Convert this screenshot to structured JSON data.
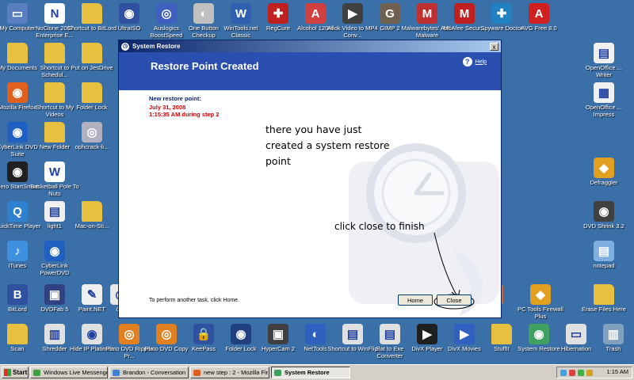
{
  "desktop": {
    "icons": [
      {
        "label": "My Computer",
        "icon": "computer-icon",
        "color": "#5a7fc0",
        "glyph": "▭"
      },
      {
        "label": "NoClone 2007 Enterprise E...",
        "icon": "noclone-icon",
        "color": "#ffffff",
        "glyph": "N"
      },
      {
        "label": "Shortcut to BitLord",
        "icon": "folder-icon",
        "color": "#e8c040",
        "glyph": ""
      },
      {
        "label": "UltraISO",
        "icon": "ultraiso-icon",
        "color": "#3050a0",
        "glyph": "◉"
      },
      {
        "label": "Auslogics BoostSpeed",
        "icon": "auslogics-icon",
        "color": "#4060c0",
        "glyph": "◎"
      },
      {
        "label": "One Button Checkup",
        "icon": "checkup-icon",
        "color": "#c0c0c0",
        "glyph": "◐"
      },
      {
        "label": "WinTools.net Classic",
        "icon": "wintools-icon",
        "color": "#3060b0",
        "glyph": "W"
      },
      {
        "label": "RegCure",
        "icon": "regcure-icon",
        "color": "#c02020",
        "glyph": "✚"
      },
      {
        "label": "Alcohol 120%",
        "icon": "alcohol-icon",
        "color": "#d04040",
        "glyph": "A"
      },
      {
        "label": "Allok Video to MP4 Conv...",
        "icon": "allok-icon",
        "color": "#404040",
        "glyph": "▶"
      },
      {
        "label": "GIMP 2",
        "icon": "gimp-icon",
        "color": "#706050",
        "glyph": "G"
      },
      {
        "label": "Malwarebytes' Anti-Malware",
        "icon": "malwarebytes-icon",
        "color": "#c03030",
        "glyph": "M"
      },
      {
        "label": "McAfee Secur...",
        "icon": "mcafee-icon",
        "color": "#c02020",
        "glyph": "M"
      },
      {
        "label": "Spyware Doctor",
        "icon": "spyware-doctor-icon",
        "color": "#2080c0",
        "glyph": "✚"
      },
      {
        "label": "AVG Free 8.0",
        "icon": "avg-icon",
        "color": "#d02020",
        "glyph": "A"
      },
      {
        "label": "My Documents",
        "icon": "documents-icon",
        "color": "#e8c040",
        "glyph": ""
      },
      {
        "label": "Shortcut to Schedul...",
        "icon": "shortcut-icon",
        "color": "#e8c040",
        "glyph": ""
      },
      {
        "label": "Put on JesDrive",
        "icon": "folder-icon",
        "color": "#e8c040",
        "glyph": ""
      },
      {
        "label": "Mozilla Firefox",
        "icon": "firefox-icon",
        "color": "#e06020",
        "glyph": "◉"
      },
      {
        "label": "Shortcut to My Videos",
        "icon": "shortcut-icon",
        "color": "#e8c040",
        "glyph": ""
      },
      {
        "label": "Folder Lock",
        "icon": "folder-icon",
        "color": "#e8c040",
        "glyph": ""
      },
      {
        "label": "CyberLink DVD Suite",
        "icon": "cyberlink-icon",
        "color": "#2060c0",
        "glyph": "◉"
      },
      {
        "label": "New Folder",
        "icon": "folder-icon",
        "color": "#e8c040",
        "glyph": ""
      },
      {
        "label": "ophcrack-li...",
        "icon": "disc-icon",
        "color": "#b0b0c0",
        "glyph": "◎"
      },
      {
        "label": "Nero StartSmart",
        "icon": "nero-icon",
        "color": "#202020",
        "glyph": "◉"
      },
      {
        "label": "Basketball Pole To Nuts",
        "icon": "document-icon",
        "color": "#ffffff",
        "glyph": "W"
      },
      {
        "label": "QuickTime Player",
        "icon": "quicktime-icon",
        "color": "#3080d0",
        "glyph": "Q"
      },
      {
        "label": "light1",
        "icon": "image-icon",
        "color": "#f0f0f0",
        "glyph": "▤"
      },
      {
        "label": "Mac-on-Sti...",
        "icon": "folder-icon",
        "color": "#e8c040",
        "glyph": ""
      },
      {
        "label": "iTunes",
        "icon": "itunes-icon",
        "color": "#4090e0",
        "glyph": "♪"
      },
      {
        "label": "CyberLink PowerDVD",
        "icon": "powerdvd-icon",
        "color": "#2060c0",
        "glyph": "◉"
      },
      {
        "label": "BitLord",
        "icon": "bitlord-icon",
        "color": "#3050a0",
        "glyph": "B"
      },
      {
        "label": "DVDFab 5",
        "icon": "dvdfab-icon",
        "color": "#304080",
        "glyph": "▣"
      },
      {
        "label": "Paint.NET",
        "icon": "paint-icon",
        "color": "#f0f0f0",
        "glyph": "✎"
      },
      {
        "label": "CD",
        "icon": "cd-icon",
        "color": "#e8e8e8",
        "glyph": "◎"
      },
      {
        "label": "ntFire",
        "icon": "fire-icon",
        "color": "#e06020",
        "glyph": "▲"
      },
      {
        "label": "PC Tools Firewall Plus",
        "icon": "firewall-icon",
        "color": "#e0a020",
        "glyph": "◆"
      },
      {
        "label": "Erase Files Here",
        "icon": "folder-icon",
        "color": "#e8c040",
        "glyph": ""
      },
      {
        "label": "OpenOffice.... Writer",
        "icon": "writer-icon",
        "color": "#f0f0f0",
        "glyph": "▤"
      },
      {
        "label": "OpenOffice.... Impress",
        "icon": "impress-icon",
        "color": "#f0f0f0",
        "glyph": "▦"
      },
      {
        "label": "Defraggler",
        "icon": "defraggler-icon",
        "color": "#e0a020",
        "glyph": "◆"
      },
      {
        "label": "DVD Shrink 3.2",
        "icon": "dvdshrink-icon",
        "color": "#404040",
        "glyph": "◉"
      },
      {
        "label": "notepad",
        "icon": "notepad-icon",
        "color": "#80b0e0",
        "glyph": "▤"
      },
      {
        "label": "Scan",
        "icon": "folder-icon",
        "color": "#e8c040",
        "glyph": ""
      },
      {
        "label": "Shredder",
        "icon": "shredder-icon",
        "color": "#e0e0e0",
        "glyph": "▥"
      },
      {
        "label": "Hide IP Platinum",
        "icon": "hideip-icon",
        "color": "#e0e0e0",
        "glyph": "◉"
      },
      {
        "label": "Plato DVD Ripper Pr...",
        "icon": "plato-icon",
        "color": "#e08020",
        "glyph": "◎"
      },
      {
        "label": "Plato DVD Copy",
        "icon": "plato-icon",
        "color": "#e08020",
        "glyph": "◎"
      },
      {
        "label": "KeePass",
        "icon": "keepass-icon",
        "color": "#3050a0",
        "glyph": "🔒"
      },
      {
        "label": "Folder Lock",
        "icon": "folderlock-icon",
        "color": "#204080",
        "glyph": "◉"
      },
      {
        "label": "HyperCam 2",
        "icon": "hypercam-icon",
        "color": "#404040",
        "glyph": "▣"
      },
      {
        "label": "NetTools",
        "icon": "nettools-icon",
        "color": "#3060c0",
        "glyph": "◐"
      },
      {
        "label": "Shortcut to WinFlip",
        "icon": "winflip-icon",
        "color": "#e0e0e0",
        "glyph": "▤"
      },
      {
        "label": "Bat to Exe Converter",
        "icon": "bat-icon",
        "color": "#e0e0e0",
        "glyph": "▤"
      },
      {
        "label": "DivX Player",
        "icon": "divx-icon",
        "color": "#202020",
        "glyph": "▶"
      },
      {
        "label": "DivX Movies",
        "icon": "divx-icon",
        "color": "#3060c0",
        "glyph": "▶"
      },
      {
        "label": "StuffIt",
        "icon": "stuffit-icon",
        "color": "#e8c040",
        "glyph": ""
      },
      {
        "label": "System Restore",
        "icon": "system-restore-icon",
        "color": "#40a060",
        "glyph": "◉"
      },
      {
        "label": "Hibernation",
        "icon": "hibernation-icon",
        "color": "#e0e0e0",
        "glyph": "▭"
      },
      {
        "label": "Trash",
        "icon": "trash-icon",
        "color": "#80a0c0",
        "glyph": "▥"
      }
    ]
  },
  "window": {
    "title": "System Restore",
    "close_glyph": "x",
    "heading": "Restore Point Created",
    "help_label": "Help",
    "new_restore_point_label": "New restore point:",
    "restore_date": "July 31, 2008",
    "restore_time": "1:15:35 AM  during step 2",
    "annotation_lines": [
      "there you have just",
      "created a system restore",
      "point"
    ],
    "annotation_click": "click close to finish",
    "bottom_text": "To perform another task, click Home.",
    "home_button": "Home",
    "close_button": "Close"
  },
  "taskbar": {
    "start_label": "Start",
    "tasks": [
      {
        "label": "Windows Live Messenger",
        "color": "#40a040"
      },
      {
        "label": "Brandon - Conversation",
        "color": "#4080d0"
      },
      {
        "label": "new step : 2 - Mozilla Fir...",
        "color": "#e06020"
      },
      {
        "label": "System Restore",
        "color": "#40a060"
      }
    ],
    "clock": "1:15 AM"
  }
}
